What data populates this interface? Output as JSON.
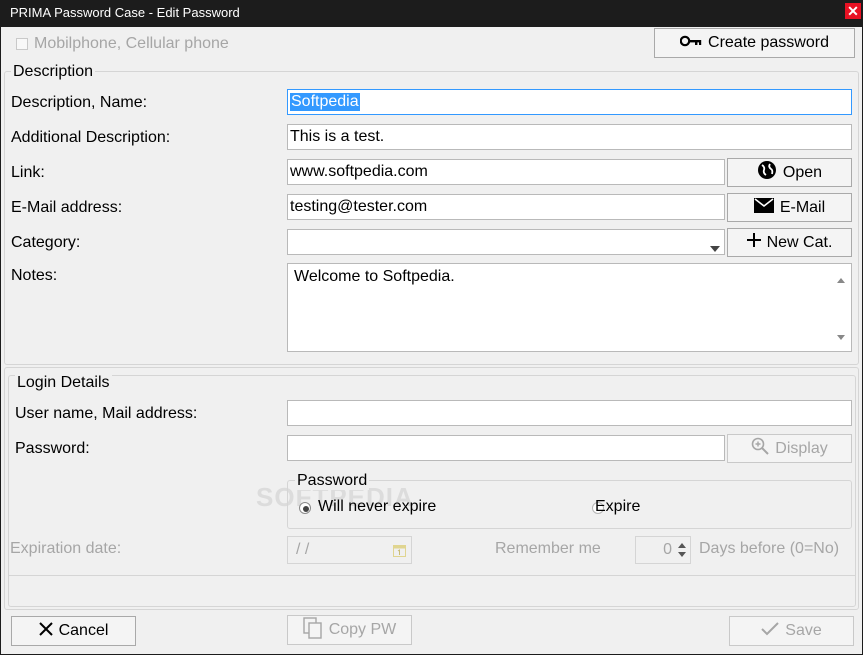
{
  "window": {
    "title": "PRIMA Password Case - Edit Password",
    "close_glyph": "✕"
  },
  "top": {
    "mobile_label": "Mobilphone, Cellular phone",
    "create_password_label": "Create password"
  },
  "description": {
    "legend": "Description",
    "name_label": "Description, Name:",
    "name_value": "Softpedia",
    "additional_label": "Additional Description:",
    "additional_value": "This is a test.",
    "link_label": "Link:",
    "link_value": "www.softpedia.com",
    "open_label": "Open",
    "email_label": "E-Mail address:",
    "email_value": "testing@tester.com",
    "email_button_label": "E-Mail",
    "category_label": "Category:",
    "category_value": "",
    "new_cat_label": "New Cat.",
    "notes_label": "Notes:",
    "notes_value": "Welcome to Softpedia."
  },
  "login": {
    "legend": "Login Details",
    "username_label": "User name, Mail address:",
    "username_value": "",
    "password_label": "Password:",
    "password_value": "",
    "display_label": "Display",
    "pw_group_legend": "Password",
    "never_expire_label": "Will never expire",
    "expire_label": "Expire",
    "expiration_label": "Expiration date:",
    "expiration_value": " /  /",
    "remember_label": "Remember me",
    "remember_value": "0",
    "days_label": "Days before (0=No)",
    "watermark": "SOFTPEDIA"
  },
  "footer": {
    "cancel_label": "Cancel",
    "copy_pw_label": "Copy PW",
    "save_label": "Save"
  },
  "icons": {
    "key": "key-icon",
    "globe": "globe-icon",
    "mail": "envelope-icon",
    "plus": "plus-icon",
    "magnifier": "magnifier-icon",
    "cross": "cross-icon",
    "copy": "copy-icon",
    "check": "checkmark-icon",
    "calendar": "calendar-icon",
    "dropdown": "chevron-down-icon"
  },
  "colors": {
    "selection": "#3399ff",
    "titlebar": "#1c1c1c",
    "close": "#e81123"
  }
}
